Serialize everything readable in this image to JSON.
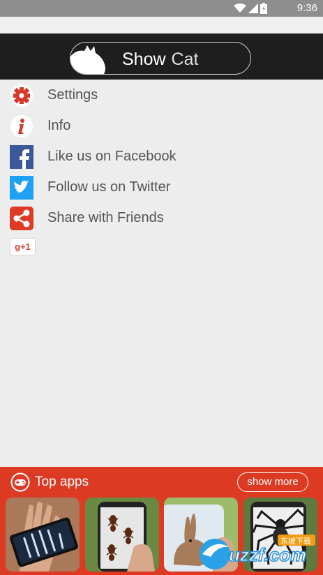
{
  "status_bar": {
    "time": "9:36"
  },
  "header": {
    "title_word1": "Show",
    "title_word2": "Cat"
  },
  "menu": {
    "items": [
      {
        "label": "Settings",
        "icon": "gear-icon"
      },
      {
        "label": "Info",
        "icon": "info-icon"
      },
      {
        "label": "Like us on Facebook",
        "icon": "facebook-icon"
      },
      {
        "label": "Follow us on Twitter",
        "icon": "twitter-icon"
      },
      {
        "label": "Share with Friends",
        "icon": "share-icon"
      }
    ],
    "gplus_label": "g+1"
  },
  "top_apps": {
    "title": "Top apps",
    "show_more": "show more",
    "apps": [
      {
        "icon": "xray-hand-app-icon"
      },
      {
        "icon": "ants-on-phone-app-icon"
      },
      {
        "icon": "rabbit-app-icon"
      },
      {
        "icon": "spider-on-phone-app-icon"
      }
    ]
  },
  "watermark": {
    "text": "uzzf.com",
    "subtext": "东坡下载"
  },
  "colors": {
    "header_bg": "#1e1e1e",
    "accent_red": "#dc3a22",
    "facebook": "#3b5998",
    "twitter": "#1da1f2",
    "share": "#dd3b24"
  }
}
